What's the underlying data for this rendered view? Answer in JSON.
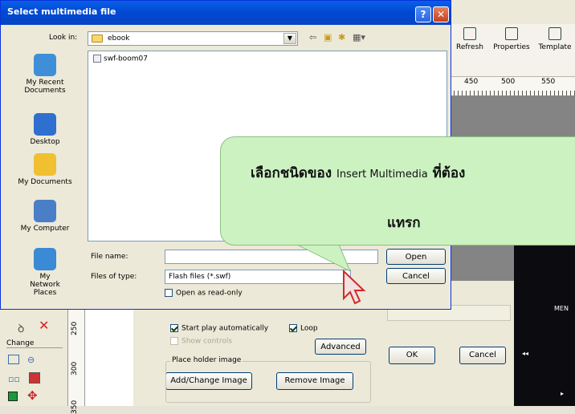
{
  "dialog": {
    "title": "Select multimedia file",
    "help_button": "?",
    "close_button": "✕",
    "look_in_label": "Look in:",
    "look_in_value": "ebook",
    "file_list": [
      "swf-boom07"
    ],
    "file_name_label": "File name:",
    "file_name_value": "",
    "files_of_type_label": "Files of type:",
    "files_of_type_value": "Flash files (*.swf)",
    "open_read_only": "Open as read-only",
    "open_button": "Open",
    "cancel_button": "Cancel"
  },
  "places": [
    {
      "label": "My Recent Documents",
      "icon": "recent-documents-icon",
      "color": "#3f8fd8"
    },
    {
      "label": "Desktop",
      "icon": "desktop-icon",
      "color": "#2f6fd0"
    },
    {
      "label": "My Documents",
      "icon": "my-documents-icon",
      "color": "#f0c030"
    },
    {
      "label": "My Computer",
      "icon": "my-computer-icon",
      "color": "#4a7fc8"
    },
    {
      "label": "My Network Places",
      "icon": "network-places-icon",
      "color": "#3a8ad6"
    }
  ],
  "toolbar": {
    "refresh": "Refresh",
    "properties": "Properties",
    "template": "Template"
  },
  "ruler": {
    "top_ticks": [
      "450",
      "500",
      "550"
    ],
    "left_ticks": [
      "250",
      "300",
      "350"
    ]
  },
  "left_panel": {
    "change_label": "Change"
  },
  "properties_dialog": {
    "start_play": "Start play automatically",
    "loop": "Loop",
    "show_controls": "Show controls",
    "advanced": "Advanced",
    "placeholder_group": "Place holder image",
    "add_change_image": "Add/Change Image",
    "remove_image": "Remove Image",
    "ok": "OK",
    "cancel": "Cancel"
  },
  "callout": {
    "line1_thai_a": "เลือกชนิดของ",
    "line1_en": "Insert Multimedia",
    "line1_thai_b": "ที่ต้อง",
    "line2": "แทรก"
  },
  "black_panel": {
    "menu_text": "MEN"
  }
}
